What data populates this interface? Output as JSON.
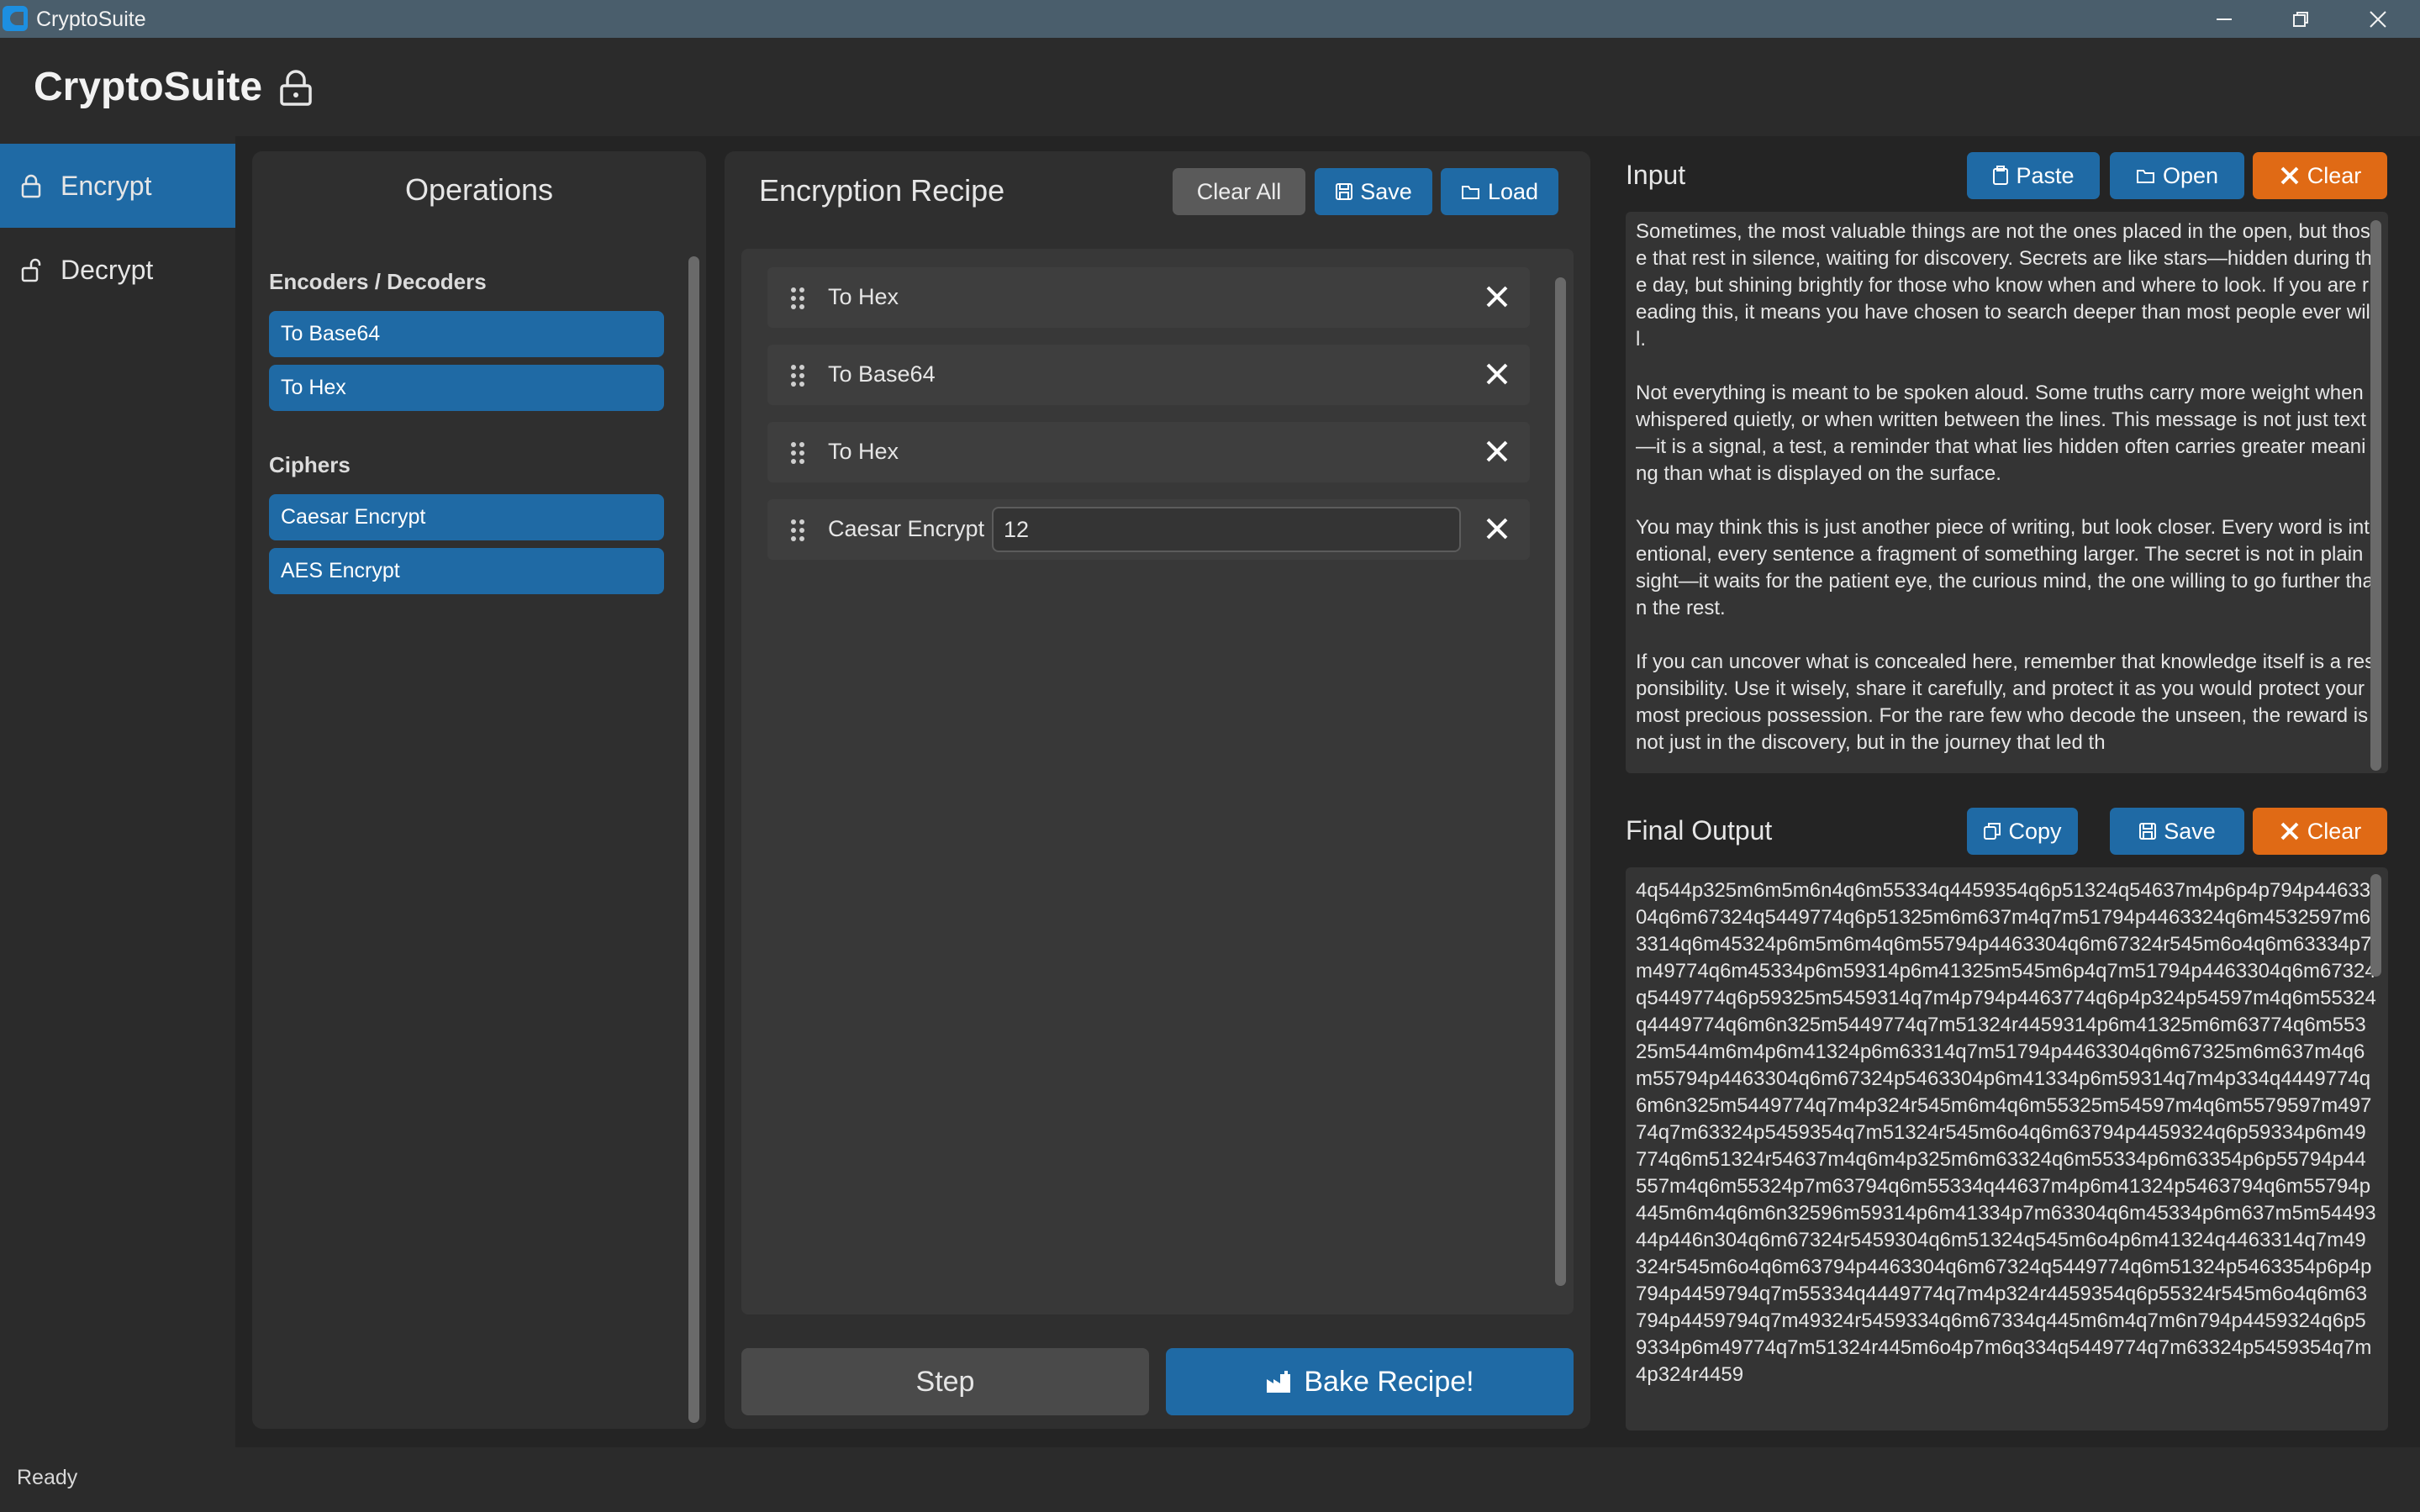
{
  "window": {
    "title": "CryptoSuite"
  },
  "header": {
    "title": "CryptoSuite"
  },
  "sidebar": {
    "items": [
      {
        "label": "Encrypt",
        "icon": "lock-icon",
        "active": true
      },
      {
        "label": "Decrypt",
        "icon": "unlock-icon",
        "active": false
      }
    ]
  },
  "operations": {
    "title": "Operations",
    "categories": [
      {
        "name": "Encoders / Decoders",
        "items": [
          "To Base64",
          "To Hex"
        ]
      },
      {
        "name": "Ciphers",
        "items": [
          "Caesar Encrypt",
          "AES Encrypt"
        ]
      }
    ]
  },
  "recipe": {
    "title": "Encryption Recipe",
    "clear_all_label": "Clear All",
    "save_label": "Save",
    "load_label": "Load",
    "steps": [
      {
        "label": "To Hex"
      },
      {
        "label": "To Base64"
      },
      {
        "label": "To Hex"
      },
      {
        "label": "Caesar Encrypt",
        "param": "12"
      }
    ],
    "step_label": "Step",
    "bake_label": "Bake Recipe!"
  },
  "input": {
    "title": "Input",
    "paste_label": "Paste",
    "open_label": "Open",
    "clear_label": "Clear",
    "text": "Sometimes, the most valuable things are not the ones placed in the open, but those that rest in silence, waiting for discovery. Secrets are like stars—hidden during the day, but shining brightly for those who know when and where to look. If you are reading this, it means you have chosen to search deeper than most people ever will.\n\nNot everything is meant to be spoken aloud. Some truths carry more weight when whispered quietly, or when written between the lines. This message is not just text—it is a signal, a test, a reminder that what lies hidden often carries greater meaning than what is displayed on the surface.\n\nYou may think this is just another piece of writing, but look closer. Every word is intentional, every sentence a fragment of something larger. The secret is not in plain sight—it waits for the patient eye, the curious mind, the one willing to go further than the rest.\n\nIf you can uncover what is concealed here, remember that knowledge itself is a responsibility. Use it wisely, share it carefully, and protect it as you would protect your most precious possession. For the rare few who decode the unseen, the reward is not just in the discovery, but in the journey that led th"
  },
  "output": {
    "title": "Final Output",
    "copy_label": "Copy",
    "save_label": "Save",
    "clear_label": "Clear",
    "text": "4q544p325m6m5m6n4q6m55334q4459354q6p51324q54637m4p6p4p794p4463304q6m67324q5449774q6p51325m6m637m4q7m51794p4463324q6m4532597m63314q6m45324p6m5m6m4q6m55794p4463304q6m67324r545m6o4q6m63334p7m49774q6m45334p6m59314p6m41325m545m6p4q7m51794p4463304q6m67324q5449774q6p59325m5459314q7m4p794p4463774q6p4p324p54597m4q6m55324q4449774q6m6n325m5449774q7m51324r4459314p6m41325m6m63774q6m55325m544m6m4p6m41324p6m63314q7m51794p4463304q6m67325m6m637m4q6m55794p4463304q6m67324p5463304p6m41334p6m59314q7m4p334q4449774q6m6n325m5449774q7m4p324r545m6m4q6m55325m54597m4q6m5579597m49774q7m63324p5459354q7m51324r545m6o4q6m63794p4459324q6p59334p6m49774q6m51324r54637m4q6m4p325m6m63324q6m55334p6m63354p6p55794p44557m4q6m55324p7m63794q6m55334q44637m4p6m41324p5463794q6m55794p445m6m4q6m6n32596m59314p6m41334p7m63304q6m45334p6m637m5m5449344p446n304q6m67324r5459304q6m51324q545m6o4p6m41324q4463314q7m49324r545m6o4q6m63794p4463304q6m67324q5449774q6m51324p5463354p6p4p794p4459794q7m55334q4449774q7m4p324r4459354q6p55324r545m6o4q6m63794p4459794q7m49324r5459334q6m67334q445m6m4q7m6n794p4459324q6p59334p6m49774q7m51324r445m6o4p7m6q334q5449774q7m63324p5459354q7m4p324r4459"
  },
  "status": {
    "text": "Ready"
  },
  "colors": {
    "accent": "#1f6aa5",
    "danger": "#e06a15",
    "neutral_button": "#5a5a5a",
    "background": "#242424",
    "titlebar": "#4a5e6c"
  }
}
